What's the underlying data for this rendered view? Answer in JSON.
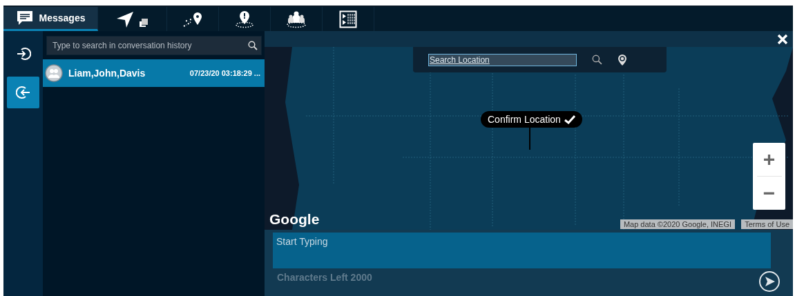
{
  "tabs": [
    {
      "kind": "messages",
      "label": "Messages",
      "selected": true
    },
    {
      "kind": "navigate",
      "selected": false
    },
    {
      "kind": "route",
      "selected": false
    },
    {
      "kind": "alert-area",
      "selected": false
    },
    {
      "kind": "group-area",
      "selected": false
    },
    {
      "kind": "media",
      "selected": false
    }
  ],
  "rail": [
    {
      "kind": "sign-in",
      "selected": false
    },
    {
      "kind": "sign-out",
      "selected": true
    }
  ],
  "conversation_search": {
    "placeholder": "Type to search in conversation history"
  },
  "conversations": [
    {
      "name": "Liam,John,Davis",
      "time": "07/23/20 03:18:29 ...",
      "selected": true
    }
  ],
  "map": {
    "search": {
      "value": "Search Location"
    },
    "tooltip": "Confirm Location",
    "zoom_in": "+",
    "zoom_out": "−",
    "logo": "Google",
    "attribution": "Map data ©2020 Google, INEGI",
    "terms": "Terms of Use"
  },
  "composer": {
    "placeholder": "Start Typing",
    "counter": "Characters Left 2000"
  }
}
